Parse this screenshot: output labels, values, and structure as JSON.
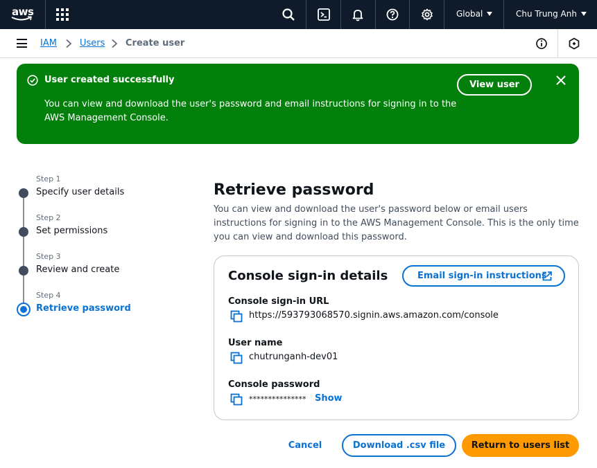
{
  "topnav": {
    "logo_text": "aws",
    "region": "Global",
    "account": "Chu Trung Anh",
    "icons": [
      "services-grid-icon",
      "search-icon",
      "cloudshell-icon",
      "notifications-icon",
      "help-icon",
      "settings-icon"
    ]
  },
  "breadcrumb": {
    "items": [
      "IAM",
      "Users"
    ],
    "current": "Create user",
    "icons": [
      "menu-icon",
      "info-icon",
      "feedback-icon"
    ]
  },
  "flash": {
    "title": "User created successfully",
    "message": "You can view and download the user's password and email instructions for signing in to the AWS Management Console.",
    "action_label": "View user",
    "color": "#037f0c"
  },
  "steps": [
    {
      "num": "Step 1",
      "label": "Specify user details",
      "state": "complete"
    },
    {
      "num": "Step 2",
      "label": "Set permissions",
      "state": "complete"
    },
    {
      "num": "Step 3",
      "label": "Review and create",
      "state": "complete"
    },
    {
      "num": "Step 4",
      "label": "Retrieve password",
      "state": "active"
    }
  ],
  "main": {
    "title": "Retrieve password",
    "description": "You can view and download the user's password below or email users instructions for signing in to the AWS Management Console. This is the only time you can view and download this password.",
    "card": {
      "title": "Console sign-in details",
      "email_button": "Email sign-in instructions",
      "fields": [
        {
          "label": "Console sign-in URL",
          "value": "https://593793068570.signin.aws.amazon.com/console"
        },
        {
          "label": "User name",
          "value": "chutrunganh-dev01"
        },
        {
          "label": "Console password",
          "value": "***************",
          "action": "Show"
        }
      ]
    }
  },
  "footer": {
    "cancel": "Cancel",
    "download": "Download .csv file",
    "return": "Return to users list"
  },
  "colors": {
    "accent": "#0972d3",
    "primary_button": "#ff9900",
    "nav_bg": "#0f1b2a"
  }
}
